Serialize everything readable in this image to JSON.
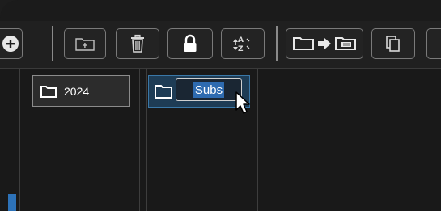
{
  "toolbar": {
    "buttons": [
      {
        "name": "add-circle-button",
        "icon": "plus-circle-icon"
      },
      {
        "name": "new-folder-button",
        "icon": "folder-plus-icon"
      },
      {
        "name": "delete-button",
        "icon": "trash-icon"
      },
      {
        "name": "lock-button",
        "icon": "lock-icon"
      },
      {
        "name": "sort-button",
        "icon": "sort-az-icon"
      },
      {
        "name": "move-to-button",
        "icon": "folder-move-icon"
      },
      {
        "name": "copy-button",
        "icon": "copy-icon"
      }
    ]
  },
  "columns": {
    "column1": {
      "items": [
        {
          "label": "2024"
        }
      ]
    },
    "column2": {
      "items": [
        {
          "label": "Subs",
          "editing": true
        }
      ]
    }
  },
  "colors": {
    "background": "#1d1d1d",
    "selection": "#1e3c55",
    "accent": "#2e6bb0"
  }
}
